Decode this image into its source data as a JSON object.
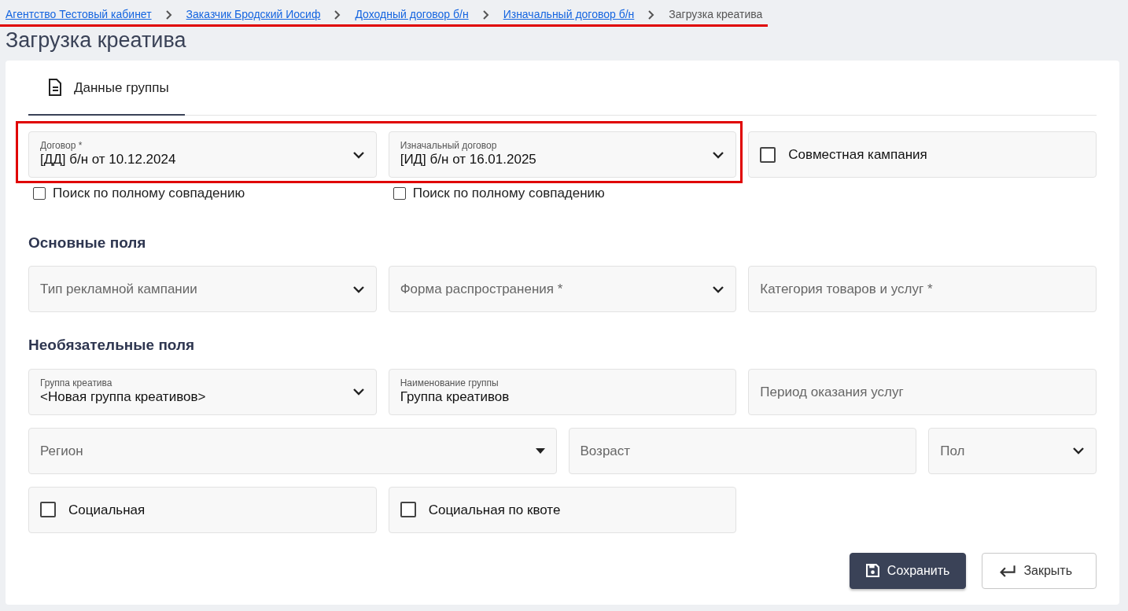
{
  "breadcrumbs": [
    {
      "text": "Агентство Тестовый кабинет",
      "link": true
    },
    {
      "text": "Заказчик Бродский Иосиф",
      "link": true
    },
    {
      "text": "Доходный договор б/н",
      "link": true
    },
    {
      "text": "Изначальный договор б/н",
      "link": true
    },
    {
      "text": "Загрузка креатива",
      "link": false
    }
  ],
  "title": "Загрузка креатива",
  "tabs": [
    {
      "label": "Данные группы",
      "selected": true
    }
  ],
  "contract_row": [
    {
      "kind": "select",
      "label": "Договор *",
      "value": "[ДД] б/н от 10.12.2024"
    },
    {
      "kind": "select",
      "label": "Изначальный договор",
      "value": "[ИД] б/н от 16.01.2025"
    },
    {
      "kind": "checkbox",
      "label": "Совместная кампания",
      "checked": false
    }
  ],
  "exact_match": [
    {
      "label": "Поиск по полному совпадению",
      "checked": false
    },
    {
      "label": "Поиск по полному совпадению",
      "checked": false
    }
  ],
  "sections": [
    {
      "heading": "Основные поля",
      "rows": [
        {
          "kind": "even",
          "items": [
            {
              "kind": "select",
              "placeholder": "Тип рекламной кампании"
            },
            {
              "kind": "select",
              "placeholder": "Форма распространения *"
            },
            {
              "kind": "input",
              "placeholder": "Категория товаров и услуг *"
            }
          ]
        }
      ]
    },
    {
      "heading": "Необязательные поля",
      "rows": [
        {
          "kind": "even",
          "items": [
            {
              "kind": "select",
              "label": "Группа креатива",
              "value": "<Новая группа креативов>"
            },
            {
              "kind": "input",
              "label": "Наименование группы",
              "value": "Группа креативов"
            },
            {
              "kind": "input",
              "placeholder": "Период оказания услуг"
            }
          ]
        },
        {
          "kind": "wide-first",
          "items": [
            {
              "kind": "dropdown",
              "placeholder": "Регион"
            },
            {
              "kind": "input",
              "placeholder": "Возраст"
            },
            {
              "kind": "select",
              "placeholder": "Пол"
            }
          ]
        },
        {
          "kind": "even",
          "items": [
            {
              "kind": "checkbox",
              "label": "Социальная",
              "checked": false
            },
            {
              "kind": "checkbox",
              "label": "Социальная по квоте",
              "checked": false
            }
          ]
        }
      ]
    }
  ],
  "buttons": [
    {
      "kind": "primary",
      "label": "Сохранить"
    },
    {
      "kind": "secondary",
      "label": "Закрыть"
    }
  ]
}
